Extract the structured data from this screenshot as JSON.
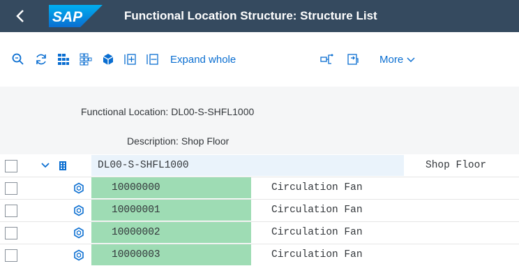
{
  "shell": {
    "back_label": "<",
    "logo_text": "SAP",
    "title": "Functional Location Structure: Structure List",
    "colors": {
      "shell_bg": "#354a5f",
      "logo_blue": "#0a6ed1"
    }
  },
  "toolbar": {
    "items": [
      {
        "icon": "find-icon"
      },
      {
        "icon": "refresh-icon"
      },
      {
        "icon": "select-all-icon"
      },
      {
        "icon": "deselect-all-icon"
      },
      {
        "icon": "object-icon"
      },
      {
        "icon": "expand-icon"
      },
      {
        "icon": "collapse-icon"
      }
    ],
    "expand_whole_label": "Expand whole",
    "more_label": "More"
  },
  "header": {
    "functional_location_label": "Functional Location:",
    "functional_location_value": "DL00-S-SHFL1000",
    "description_label": "Description:",
    "description_value": "Shop Floor"
  },
  "tree": {
    "root": {
      "id": "DL00-S-SHFL1000",
      "description": "Shop Floor"
    },
    "rows": [
      {
        "id": "10000000",
        "description": "Circulation Fan"
      },
      {
        "id": "10000001",
        "description": "Circulation Fan"
      },
      {
        "id": "10000002",
        "description": "Circulation Fan"
      },
      {
        "id": "10000003",
        "description": "Circulation Fan"
      }
    ]
  }
}
